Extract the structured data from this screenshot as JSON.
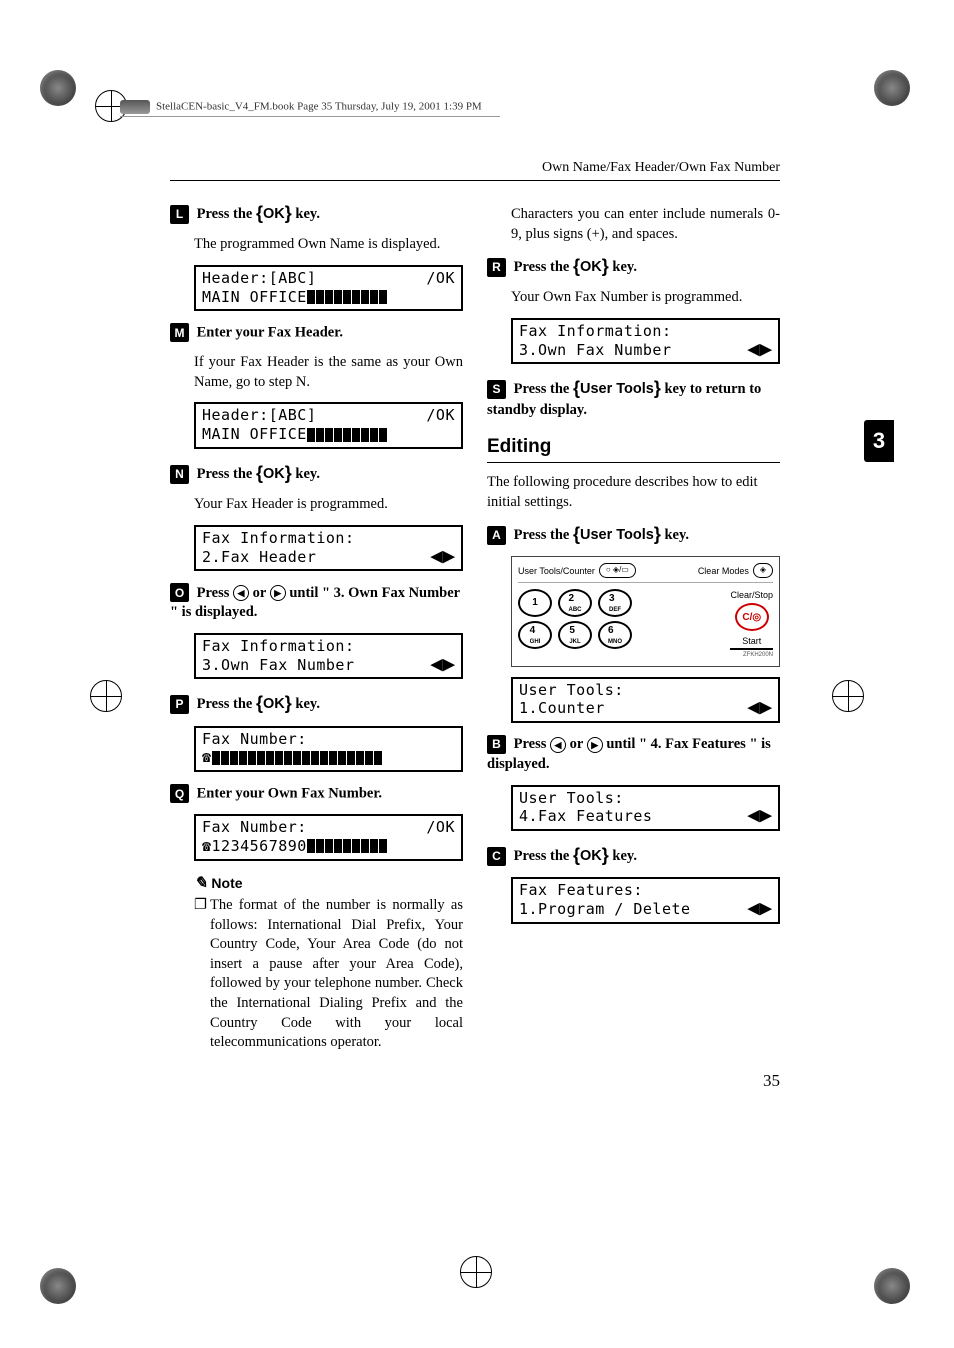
{
  "header_runner": "StellaCEN-basic_V4_FM.book  Page 35  Thursday, July 19, 2001  1:39 PM",
  "page_header": "Own Name/Fax Header/Own Fax Number",
  "chapter_tab": "3",
  "page_number": "35",
  "left": {
    "s12": {
      "num": "L",
      "text": "Press the 【OK】 key.",
      "body": "The programmed Own Name is displayed."
    },
    "lcd1": {
      "l1a": "Header:[ABC]",
      "l1b": "/OK",
      "l2": "MAIN OFFICE"
    },
    "s13": {
      "num": "M",
      "text": "Enter your Fax Header.",
      "body": "If your Fax Header is the same as your Own Name, go to step N."
    },
    "lcd2": {
      "l1a": "Header:[ABC]",
      "l1b": "/OK",
      "l2": "MAIN OFFICE"
    },
    "s14": {
      "num": "N",
      "text": "Press the 【OK】 key.",
      "body": "Your Fax Header is programmed."
    },
    "lcd3": {
      "l1": "Fax Information:",
      "l2": "2.Fax Header"
    },
    "s15": {
      "num": "O",
      "text": "Press 0 or 1 until \" 3. Own Fax Number \" is displayed."
    },
    "lcd4": {
      "l1": "Fax Information:",
      "l2": "3.Own Fax Number"
    },
    "s16": {
      "num": "P",
      "text": "Press the 【OK】 key."
    },
    "lcd5": {
      "l1": "Fax Number:"
    },
    "s17": {
      "num": "Q",
      "text": "Enter your Own Fax Number."
    },
    "lcd6": {
      "l1a": "Fax Number:",
      "l1b": "/OK",
      "l2": "1234567890"
    },
    "note_label": "Note",
    "note_body": "The format of the number is normally as follows: International Dial Prefix, Your Country Code, Your Area Code (do not insert a pause after your Area Code), followed by your telephone number. Check the International Dialing Prefix and the Country Code with your local telecommunications operator."
  },
  "right": {
    "intro_body": "Characters you can enter include numerals 0-9, plus signs (+), and spaces.",
    "s18": {
      "num": "R",
      "text": "Press the 【OK】 key.",
      "body": "Your Own Fax Number is programmed."
    },
    "lcd7": {
      "l1": "Fax Information:",
      "l2": "3.Own Fax Number"
    },
    "s19": {
      "num": "S",
      "text": "Press the 【User Tools】 key to return to standby display."
    },
    "section_title": "Editing",
    "section_intro": "The following procedure describes how to edit initial settings.",
    "e1": {
      "num": "A",
      "text": "Press the 【User Tools】 key."
    },
    "panel": {
      "top_left": "User Tools/Counter",
      "top_right": "Clear Modes",
      "keys": [
        {
          "n": "1",
          "sub": ""
        },
        {
          "n": "2",
          "sub": "ABC"
        },
        {
          "n": "3",
          "sub": "DEF"
        },
        {
          "n": "4",
          "sub": "GHI"
        },
        {
          "n": "5",
          "sub": "JKL"
        },
        {
          "n": "6",
          "sub": "MNO"
        }
      ],
      "clear_stop": "Clear/Stop",
      "cs_sym": "C/◎",
      "start": "Start",
      "id": "ZFKH200N"
    },
    "lcd8": {
      "l1": "User Tools:",
      "l2": "1.Counter"
    },
    "e2": {
      "num": "B",
      "text": "Press 0 or 1 until \" 4. Fax Features \" is displayed."
    },
    "lcd9": {
      "l1": "User Tools:",
      "l2": "4.Fax Features"
    },
    "e3": {
      "num": "C",
      "text": "Press the 【OK】 key."
    },
    "lcd10": {
      "l1": "Fax Features:",
      "l2": "1.Program / Delete"
    }
  }
}
